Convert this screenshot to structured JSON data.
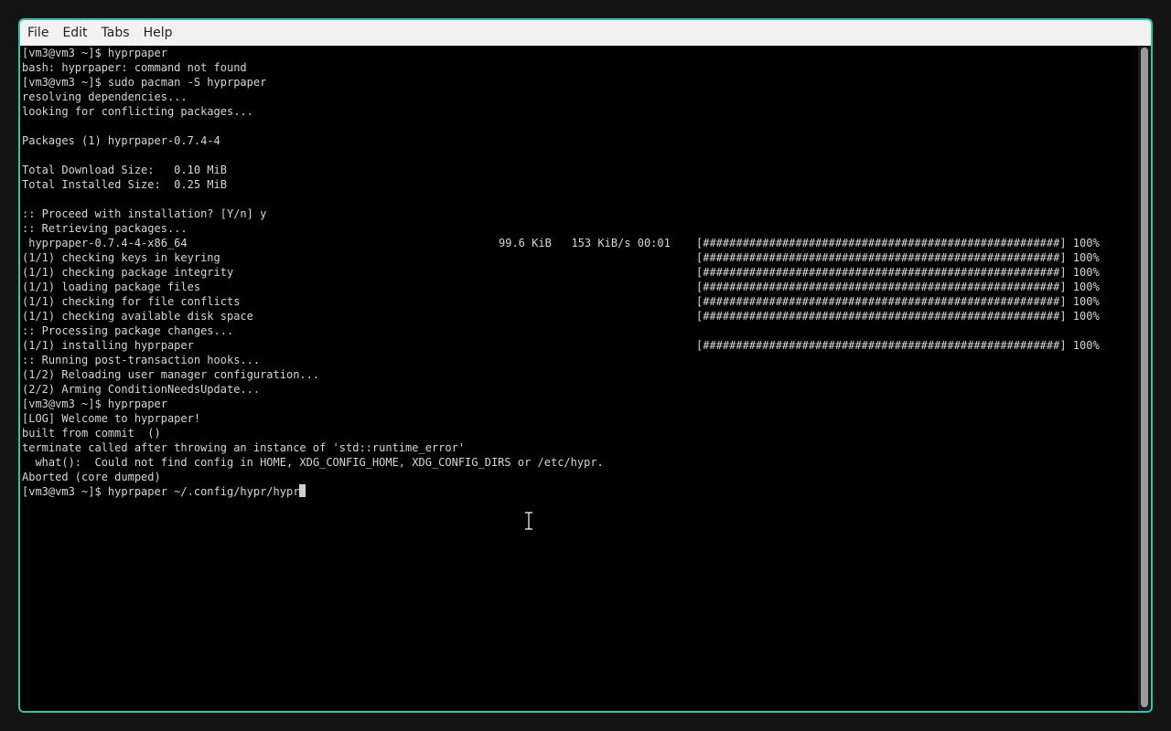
{
  "menu": {
    "items": [
      "File",
      "Edit",
      "Tabs",
      "Help"
    ]
  },
  "terminal": {
    "lines": [
      {
        "text": "[vm3@vm3 ~]$ hyprpaper"
      },
      {
        "text": "bash: hyprpaper: command not found"
      },
      {
        "text": "[vm3@vm3 ~]$ sudo pacman -S hyprpaper"
      },
      {
        "text": "resolving dependencies..."
      },
      {
        "text": "looking for conflicting packages..."
      },
      {
        "text": ""
      },
      {
        "text": "Packages (1) hyprpaper-0.7.4-4"
      },
      {
        "text": ""
      },
      {
        "text": "Total Download Size:   0.10 MiB"
      },
      {
        "text": "Total Installed Size:  0.25 MiB"
      },
      {
        "text": ""
      },
      {
        "text": ":: Proceed with installation? [Y/n] y"
      },
      {
        "text": ":: Retrieving packages..."
      },
      {
        "text": " hyprpaper-0.7.4-4-x86_64",
        "right": "99.6 KiB   153 KiB/s 00:01",
        "bar": "[######################################################] 100%"
      },
      {
        "text": "(1/1) checking keys in keyring",
        "bar": "[######################################################] 100%"
      },
      {
        "text": "(1/1) checking package integrity",
        "bar": "[######################################################] 100%"
      },
      {
        "text": "(1/1) loading package files",
        "bar": "[######################################################] 100%"
      },
      {
        "text": "(1/1) checking for file conflicts",
        "bar": "[######################################################] 100%"
      },
      {
        "text": "(1/1) checking available disk space",
        "bar": "[######################################################] 100%"
      },
      {
        "text": ":: Processing package changes..."
      },
      {
        "text": "(1/1) installing hyprpaper",
        "bar": "[######################################################] 100%"
      },
      {
        "text": ":: Running post-transaction hooks..."
      },
      {
        "text": "(1/2) Reloading user manager configuration..."
      },
      {
        "text": "(2/2) Arming ConditionNeedsUpdate..."
      },
      {
        "text": "[vm3@vm3 ~]$ hyprpaper"
      },
      {
        "text": "[LOG] Welcome to hyprpaper!"
      },
      {
        "text": "built from commit  ()"
      },
      {
        "text": "terminate called after throwing an instance of 'std::runtime_error'"
      },
      {
        "text": "  what():  Could not find config in HOME, XDG_CONFIG_HOME, XDG_CONFIG_DIRS or /etc/hypr."
      },
      {
        "text": "Aborted (core dumped)"
      }
    ],
    "prompt_line": "[vm3@vm3 ~]$ hyprpaper ~/.config/hypr/hypr"
  },
  "colors": {
    "border_accent": "#2ec4a7",
    "terminal_bg": "#000000",
    "terminal_fg": "#d6d6d6",
    "menubar_bg": "#f2f2f2"
  },
  "icons": {
    "mouse_pointer": "ibeam-cursor-icon"
  }
}
